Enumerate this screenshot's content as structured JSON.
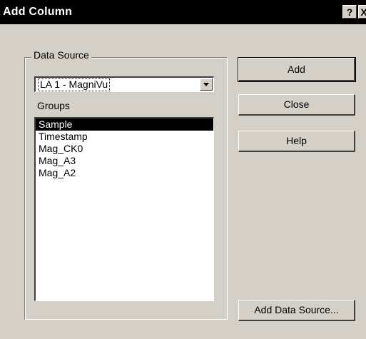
{
  "window": {
    "title": "Add Column",
    "help_button": "?",
    "close_button": "X"
  },
  "data_source": {
    "group_label": "Data Source",
    "selected": "LA 1 - MagniVu"
  },
  "groups": {
    "label": "Groups",
    "items": [
      {
        "label": "Sample",
        "selected": true
      },
      {
        "label": "Timestamp",
        "selected": false
      },
      {
        "label": "Mag_CK0",
        "selected": false
      },
      {
        "label": "Mag_A3",
        "selected": false
      },
      {
        "label": "Mag_A2",
        "selected": false
      }
    ]
  },
  "buttons": {
    "add": "Add",
    "close": "Close",
    "help": "Help",
    "add_data_source": "Add Data Source..."
  },
  "icons": {
    "dropdown": "chevron-down-icon"
  }
}
